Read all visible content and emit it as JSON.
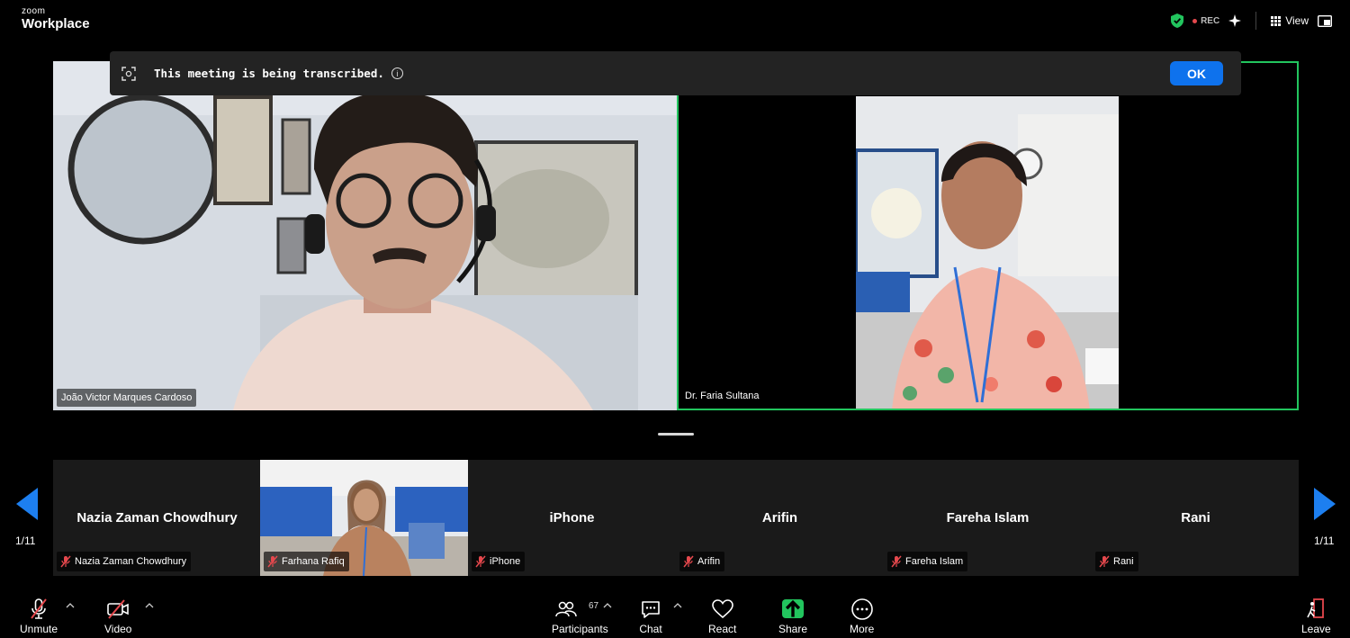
{
  "app": {
    "brand_small": "zoom",
    "brand_large": "Workplace"
  },
  "topbar": {
    "rec_label": "REC",
    "view_label": "View"
  },
  "banner": {
    "text": "This meeting is being transcribed.",
    "info_glyph": "i",
    "ok_label": "OK"
  },
  "main_videos": [
    {
      "name": "João Victor Marques Cardoso"
    },
    {
      "name": "Dr. Faria Sultana",
      "active_speaker": true
    }
  ],
  "gallery": {
    "page_left": "1/11",
    "page_right": "1/11",
    "tiles": [
      {
        "display_name": "Nazia Zaman Chowdhury",
        "tag": "Nazia Zaman Chowdhury",
        "muted": true,
        "video": false
      },
      {
        "display_name": "",
        "tag": "Farhana Rafiq",
        "muted": true,
        "video": true
      },
      {
        "display_name": "iPhone",
        "tag": "iPhone",
        "muted": true,
        "video": false
      },
      {
        "display_name": "Arifin",
        "tag": "Arifin",
        "muted": true,
        "video": false
      },
      {
        "display_name": "Fareha Islam",
        "tag": "Fareha Islam",
        "muted": true,
        "video": false
      },
      {
        "display_name": "Rani",
        "tag": "Rani",
        "muted": true,
        "video": false
      }
    ]
  },
  "toolbar": {
    "unmute": "Unmute",
    "video": "Video",
    "participants": "Participants",
    "participants_count": "67",
    "chat": "Chat",
    "react": "React",
    "share": "Share",
    "more": "More",
    "leave": "Leave"
  },
  "colors": {
    "accent": "#0e72ed",
    "active_border": "#22c55e",
    "share_green": "#22c55e",
    "muted_red": "#e5484d",
    "strip_bg": "#1a1a1a",
    "banner_bg": "#232323"
  },
  "icons": [
    "shield-check-icon",
    "sparkle-icon",
    "view-grid-icon",
    "popout-icon",
    "transcript-icon",
    "info-icon",
    "mic-off-icon",
    "video-off-icon",
    "participants-icon",
    "chat-icon",
    "heart-icon",
    "share-arrow-icon",
    "more-icon",
    "leave-icon"
  ]
}
